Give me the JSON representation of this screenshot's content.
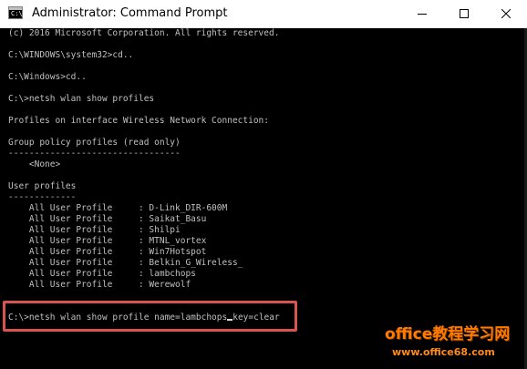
{
  "window": {
    "title": "Administrator: Command Prompt",
    "icon": "cmd-icon",
    "controls": {
      "minimize": "minimize-icon",
      "maximize": "maximize-icon",
      "close": "close-icon"
    }
  },
  "console": {
    "lines": [
      "(c) 2016 Microsoft Corporation. All rights reserved.",
      "",
      "C:\\WINDOWS\\system32>cd..",
      "",
      "C:\\Windows>cd..",
      "",
      "C:\\>netsh wlan show profiles",
      "",
      "Profiles on interface Wireless Network Connection:",
      "",
      "Group policy profiles (read only)",
      "---------------------------------",
      "    <None>",
      "",
      "User profiles",
      "-------------",
      "    All User Profile     : D-Link_DIR-600M",
      "    All User Profile     : Saikat_Basu",
      "    All User Profile     : Shilpi",
      "    All User Profile     : MTNL_vortex",
      "    All User Profile     : Win7Hotspot",
      "    All User Profile     : Belkin_G_Wireless_",
      "    All User Profile     : lambchops",
      "    All User Profile     : Werewolf"
    ],
    "command_before_cursor": "C:\\>netsh wlan show profile name=lambchops",
    "command_after_cursor": "key=clear"
  },
  "watermark": {
    "line1": "office教程学习网",
    "line2": "www.office68.com"
  },
  "colors": {
    "console_bg": "#000000",
    "console_text": "#c0c0c0",
    "highlight_border": "#d9534f",
    "watermark": "#ff7a00"
  }
}
